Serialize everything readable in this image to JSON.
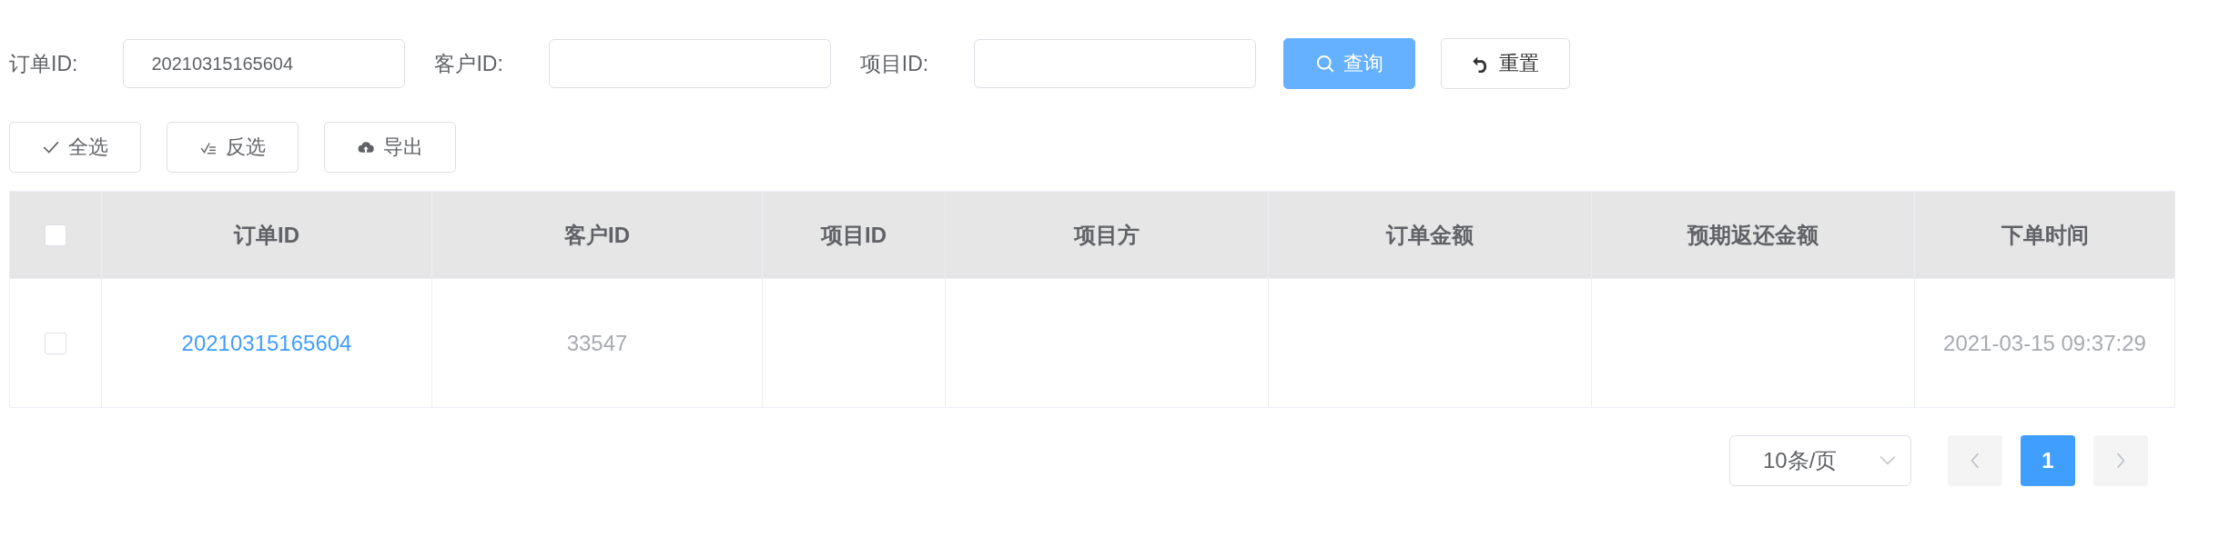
{
  "search_form": {
    "fields": [
      {
        "label": "订单ID:",
        "value": "20210315165604"
      },
      {
        "label": "客户ID:"
      },
      {
        "label": "项目ID:"
      }
    ],
    "buttons": [
      {
        "kind": "primary",
        "label": "查询"
      },
      {
        "kind": "default",
        "label": "重置"
      }
    ]
  },
  "toolbar": [
    {
      "label": "全选",
      "kind": "check"
    },
    {
      "label": "反选",
      "kind": "checklist"
    },
    {
      "label": "导出",
      "kind": "upload"
    }
  ],
  "table": {
    "header_checked": false,
    "columns": [
      "订单ID",
      "客户ID",
      "项目ID",
      "项目方",
      "订单金额",
      "预期返还金额",
      "下单时间"
    ],
    "rows": [
      {
        "checked": false,
        "cells": [
          "20210315165604",
          "33547",
          "",
          "",
          "",
          "",
          "2021-03-15 09:37:29"
        ]
      }
    ]
  },
  "pagination": {
    "page_size": "10条/页",
    "pages": [
      {
        "label": "1",
        "selected": true
      }
    ]
  }
}
